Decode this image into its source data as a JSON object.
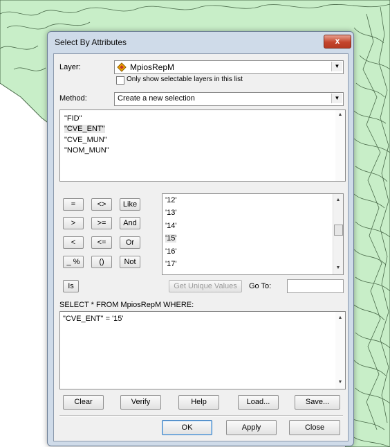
{
  "dialog": {
    "title": "Select By Attributes",
    "close_glyph": "x",
    "layer_label": "Layer:",
    "layer_value": "MpiosRepM",
    "layer_icon": "layer-diamond-icon",
    "only_selectable_label": "Only show selectable layers in this list",
    "only_selectable_checked": false,
    "method_label": "Method:",
    "method_value": "Create a new selection",
    "fields": [
      "\"FID\"",
      "\"CVE_ENT\"",
      "\"CVE_MUN\"",
      "\"NOM_MUN\""
    ],
    "fields_selected_index": 1,
    "operators": [
      [
        "=",
        "<>",
        "Like"
      ],
      [
        ">",
        ">=",
        "And"
      ],
      [
        "<",
        "<=",
        "Or"
      ],
      [
        "_ %",
        "()",
        "Not"
      ]
    ],
    "is_button": "Is",
    "values": [
      "'12'",
      "'13'",
      "'14'",
      "'15'",
      "'16'",
      "'17'"
    ],
    "values_selected_index": 3,
    "get_unique_values_label": "Get Unique Values",
    "go_to_label": "Go To:",
    "go_to_value": "",
    "sql_label": "SELECT * FROM MpiosRepM WHERE:",
    "sql_expression": "\"CVE_ENT\" = '15'",
    "expr_buttons": [
      "Clear",
      "Verify",
      "Help",
      "Load...",
      "Save..."
    ],
    "ok_label": "OK",
    "apply_label": "Apply",
    "close_label": "Close"
  },
  "colors": {
    "map_fill": "#c8eec8",
    "map_boundary": "#4a6a4a",
    "dialog_frame": "#cfdbe9",
    "client_bg": "#f0f0f0",
    "close_red": "#c4442c"
  }
}
